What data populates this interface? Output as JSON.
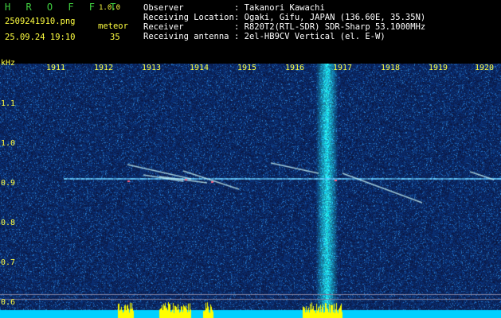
{
  "header": {
    "app_name": "H R O F F T",
    "app_version": "1.0.0",
    "file_name": "2509241910.png",
    "mode": "meteor",
    "timestamp": "25.09.24 19:10",
    "meteor_count": "35",
    "info": [
      {
        "key": "Observer",
        "value": ": Takanori Kawachi"
      },
      {
        "key": "Receiving Location",
        "value": ": Ogaki, Gifu, JAPAN (136.60E, 35.35N)"
      },
      {
        "key": "Receiver",
        "value": ": R820T2(RTL-SDR) SDR-Sharp 53.1000MHz"
      },
      {
        "key": "Receiving antenna",
        "value": ": 2el-HB9CV Vertical (el. E-W)"
      }
    ]
  },
  "axes": {
    "unit": "kHz",
    "time_ticks": [
      "1911",
      "1912",
      "1913",
      "1914",
      "1915",
      "1916",
      "1917",
      "1918",
      "1919",
      "1920"
    ],
    "freq_ticks": [
      "1.1",
      "1.0",
      "0.9",
      "0.8",
      "0.7",
      "0.6"
    ]
  },
  "colors": {
    "background": "#0a0a4a",
    "header_text_green": "#40d040",
    "header_text_yellow": "#ffff40",
    "carrier_line": "#66ccff",
    "echo_line": "#d0ffff",
    "level_bars": "#ffff00",
    "baseline": "#00d0ff"
  }
}
